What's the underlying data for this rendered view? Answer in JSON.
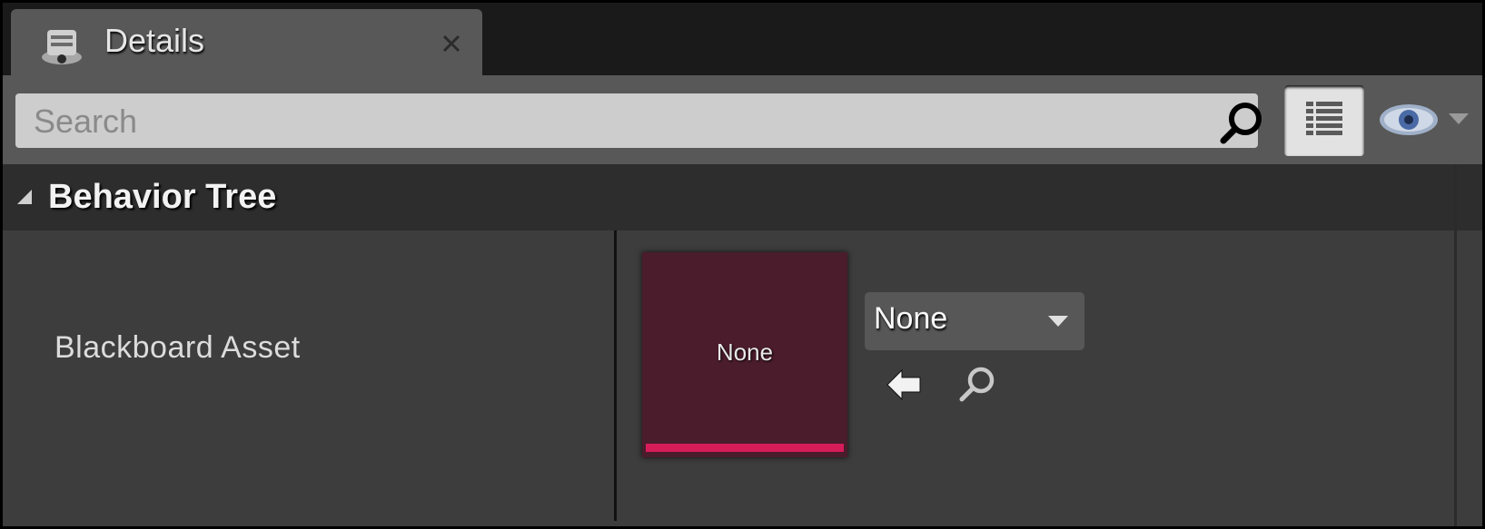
{
  "tab": {
    "title": "Details",
    "icon": "details-panel-icon",
    "close_icon": "close-icon"
  },
  "search": {
    "placeholder": "Search",
    "value": "",
    "icon": "search-icon"
  },
  "toolbar": {
    "view_options_icon": "grid-view-icon",
    "visibility_icon": "eye-icon"
  },
  "section": {
    "title": "Behavior Tree",
    "expanded": true
  },
  "property": {
    "label": "Blackboard Asset",
    "thumbnail_text": "None",
    "selected_value": "None",
    "accent_color": "#d61d59"
  },
  "colors": {
    "background": "#1a1a1a",
    "tab": "#585858",
    "row": "#3d3d3d",
    "header": "#2d2d2d",
    "thumbnail": "#4a1c2c"
  }
}
